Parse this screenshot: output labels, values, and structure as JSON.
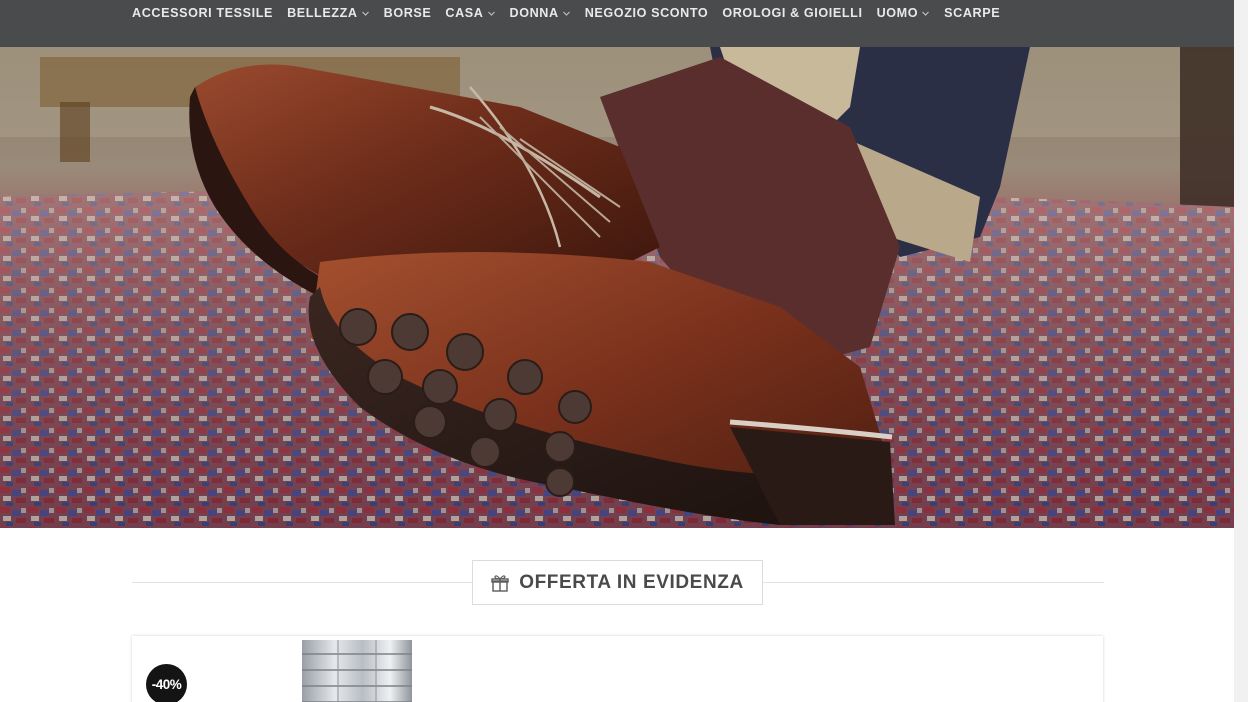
{
  "nav": {
    "items": [
      {
        "label": "ACCESSORI TESSILE",
        "dropdown": false
      },
      {
        "label": "BELLEZZA",
        "dropdown": true
      },
      {
        "label": "BORSE",
        "dropdown": false
      },
      {
        "label": "CASA",
        "dropdown": true
      },
      {
        "label": "DONNA",
        "dropdown": true
      },
      {
        "label": "NEGOZIO SCONTO",
        "dropdown": false
      },
      {
        "label": "OROLOGI & GIOIELLI",
        "dropdown": false
      },
      {
        "label": "UOMO",
        "dropdown": true
      },
      {
        "label": "SCARPE",
        "dropdown": false
      }
    ]
  },
  "hero": {
    "image": "leather-shoes-on-persian-rug"
  },
  "featured": {
    "title": "OFFERTA IN EVIDENZA",
    "icon": "gift-icon"
  },
  "product": {
    "discount_badge": "-40%",
    "image": "steel-watch-bracelet"
  },
  "colors": {
    "nav_bg": "#4a4b4d",
    "nav_text": "#e9e9e9",
    "badge_bg": "#141414",
    "title_text": "#4a4a4a"
  }
}
